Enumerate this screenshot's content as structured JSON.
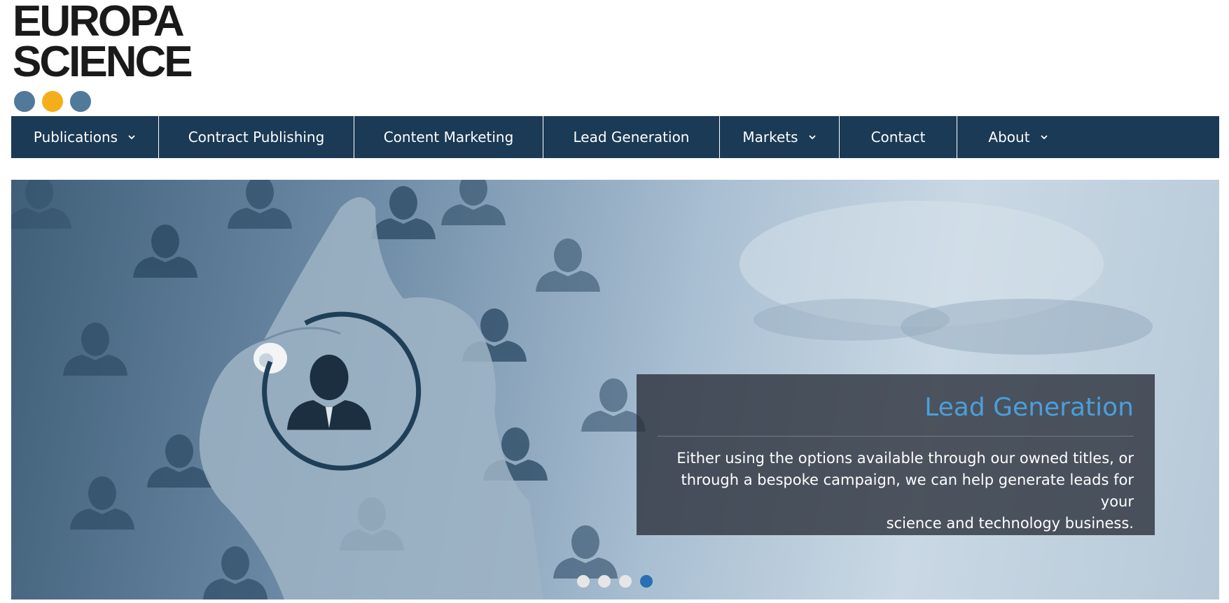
{
  "logo": {
    "line1": "EUROPA",
    "line2": "SCIENCE",
    "dot_colors": [
      "#51799a",
      "#f5ae1b",
      "#51799a"
    ]
  },
  "nav": {
    "items": [
      {
        "label": "Publications",
        "dropdown": true
      },
      {
        "label": "Contract Publishing",
        "dropdown": false
      },
      {
        "label": "Content Marketing",
        "dropdown": false
      },
      {
        "label": "Lead Generation",
        "dropdown": false
      },
      {
        "label": "Markets",
        "dropdown": true
      },
      {
        "label": "Contact",
        "dropdown": false
      },
      {
        "label": "About",
        "dropdown": true
      }
    ]
  },
  "slider": {
    "caption_title": "Lead Generation",
    "caption_body_line1": "Either using the options available through our owned titles, or",
    "caption_body_line2": "through a bespoke campaign, we can help generate leads for your",
    "caption_body_line3": "science and technology business.",
    "slide_count": 4,
    "active_slide": 4
  },
  "colors": {
    "nav_bg": "#1a3a55",
    "caption_title": "#4a9fdc",
    "dot_active": "#2a6fb5",
    "dot_inactive": "#e6e6e6"
  }
}
